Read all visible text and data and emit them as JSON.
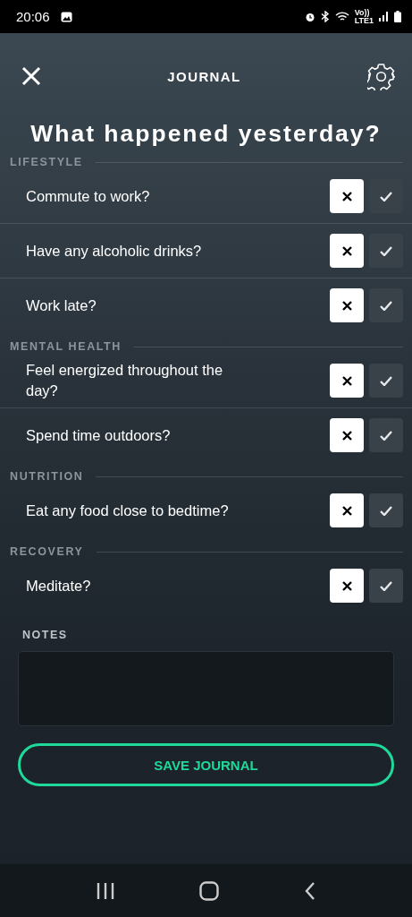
{
  "status_bar": {
    "time": "20:06",
    "network": [
      "Vo))",
      "LTE1"
    ]
  },
  "header": {
    "title": "JOURNAL"
  },
  "heading": "What happened yesterday?",
  "sections": [
    {
      "title": "LIFESTYLE",
      "questions": [
        {
          "text": "Commute to work?",
          "no_selected": true,
          "yes_selected": false
        },
        {
          "text": "Have any alcoholic drinks?",
          "no_selected": true,
          "yes_selected": false
        },
        {
          "text": "Work late?",
          "no_selected": true,
          "yes_selected": false
        }
      ]
    },
    {
      "title": "MENTAL HEALTH",
      "questions": [
        {
          "text": "Feel energized throughout the day?",
          "no_selected": true,
          "yes_selected": false
        },
        {
          "text": "Spend time outdoors?",
          "no_selected": true,
          "yes_selected": false
        }
      ]
    },
    {
      "title": "NUTRITION",
      "questions": [
        {
          "text": "Eat any food close to bedtime?",
          "no_selected": true,
          "yes_selected": false
        }
      ]
    },
    {
      "title": "RECOVERY",
      "questions": [
        {
          "text": "Meditate?",
          "no_selected": true,
          "yes_selected": false
        }
      ]
    }
  ],
  "notes": {
    "label": "NOTES"
  },
  "save_button": "SAVE JOURNAL"
}
